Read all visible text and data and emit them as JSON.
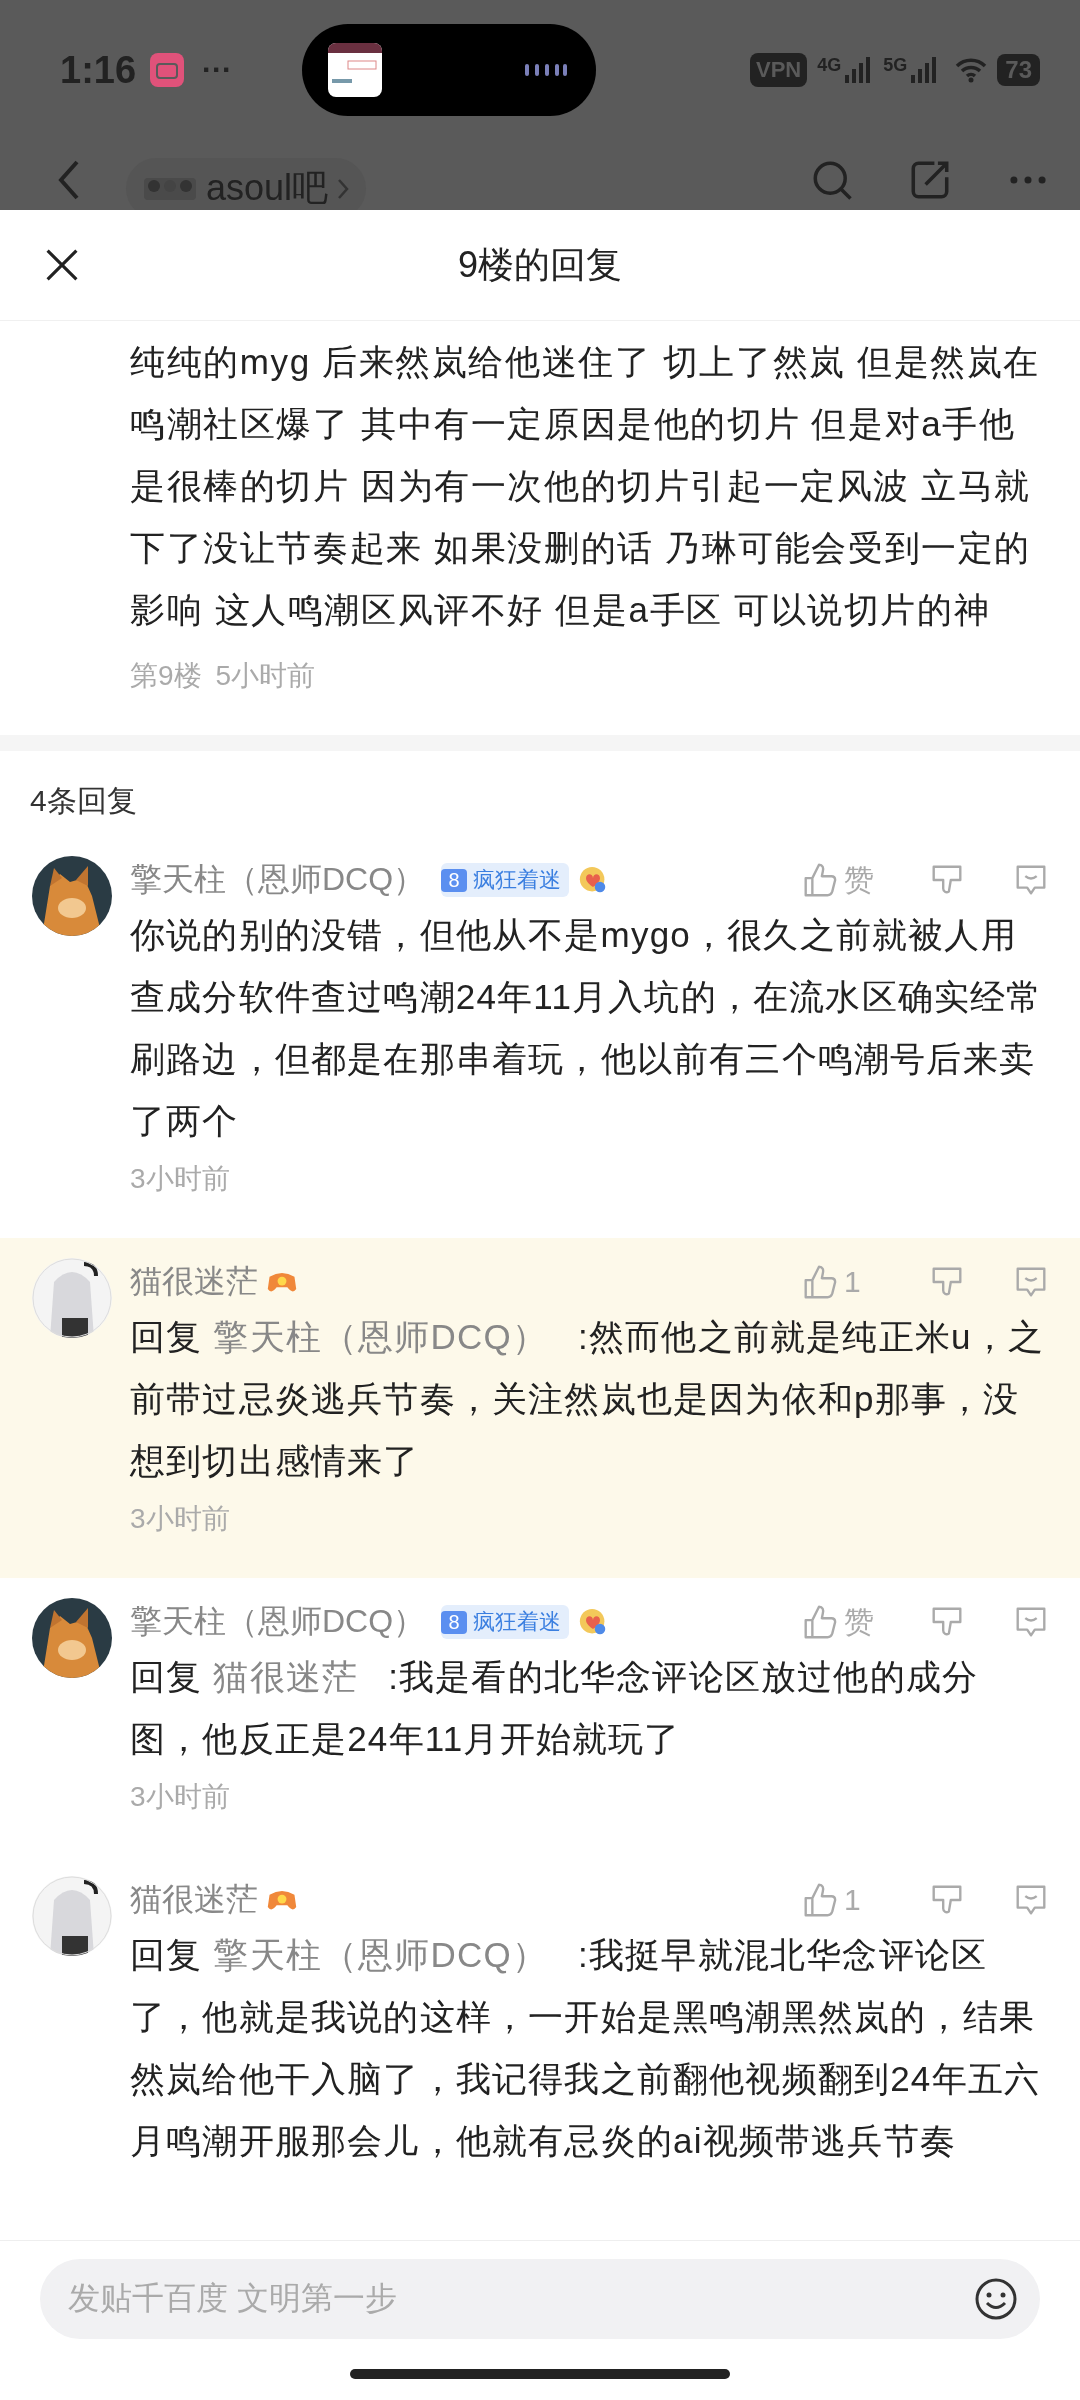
{
  "status_bar": {
    "time": "1:16",
    "more": "···",
    "vpn": "VPN",
    "net_1": "4G",
    "net_2": "5G",
    "battery": "73"
  },
  "nav": {
    "forum": "asoul吧"
  },
  "sheet": {
    "title": "9楼的回复"
  },
  "post": {
    "text": "纯纯的myg 后来然岚给他迷住了 切上了然岚 但是然岚在鸣潮社区爆了 其中有一定原因是他的切片 但是对a手他是很棒的切片 因为有一次他的切片引起一定风波 立马就下了没让节奏起来 如果没删的话 乃琳可能会受到一定的影响 这人鸣潮区风评不好 但是a手区 可以说切片的神",
    "floor": "第9楼",
    "time": "5小时前"
  },
  "replies_count": "4条回复",
  "comments": [
    {
      "name": "擎天柱（恩师DCQ）",
      "kind": "cat",
      "badge": {
        "level": "8",
        "title": "疯狂着迷"
      },
      "like": "赞",
      "text": "你说的别的没错，但他从不是mygo，很久之前就被人用查成分软件查过鸣潮24年11月入坑的，在流水区确实经常刷路边，但都是在那串着玩，他以前有三个鸣潮号后来卖了两个",
      "time": "3小时前",
      "highlighted": false
    },
    {
      "name": "猫很迷茫",
      "kind": "girl",
      "like": "1",
      "reply_label": "回复",
      "reply_to": "擎天柱（恩师DCQ）",
      "text": ":然而他之前就是纯正米u，之前带过忌炎逃兵节奏，关注然岚也是因为依和p那事，没想到切出感情来了",
      "time": "3小时前",
      "highlighted": true
    },
    {
      "name": "擎天柱（恩师DCQ）",
      "kind": "cat",
      "badge": {
        "level": "8",
        "title": "疯狂着迷"
      },
      "like": "赞",
      "reply_label": "回复",
      "reply_to": "猫很迷茫",
      "text": ":我是看的北华念评论区放过他的成分图，他反正是24年11月开始就玩了",
      "time": "3小时前",
      "highlighted": false
    },
    {
      "name": "猫很迷茫",
      "kind": "girl",
      "like": "1",
      "reply_label": "回复",
      "reply_to": "擎天柱（恩师DCQ）",
      "text": ":我挺早就混北华念评论区了，他就是我说的这样，一开始是黑鸣潮黑然岚的，结果然岚给他干入脑了，我记得我之前翻他视频翻到24年五六月鸣潮开服那会儿，他就有忌炎的ai视频带逃兵节奏",
      "highlighted": false
    }
  ],
  "composer": {
    "placeholder": "发贴千百度 文明第一步"
  }
}
